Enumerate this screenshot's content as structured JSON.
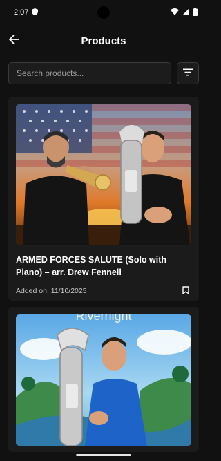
{
  "status": {
    "time": "2:07",
    "icons": [
      "shield-icon",
      "wifi-icon",
      "signal-icon",
      "battery-icon"
    ]
  },
  "header": {
    "title": "Products",
    "back_icon": "arrow-left-icon"
  },
  "search": {
    "placeholder": "Search products...",
    "value": "",
    "filter_icon": "filter-icon"
  },
  "products": [
    {
      "title": "ARMED FORCES SALUTE (Solo with Piano) – arr. Drew Fennell",
      "added_label": "Added on: 11/10/2025",
      "bookmark_icon": "bookmark-icon",
      "image": "Two musicians playing trumpet and euphonium in front of an American flag and sunset"
    },
    {
      "image_text": "Rivernight",
      "image": "Musician playing euphonium in an illustrated river landscape"
    }
  ],
  "colors": {
    "background": "#111111",
    "card": "#1b1b1b",
    "field": "#1c1c1c",
    "text": "#ffffff",
    "muted": "#c8c8c8"
  }
}
